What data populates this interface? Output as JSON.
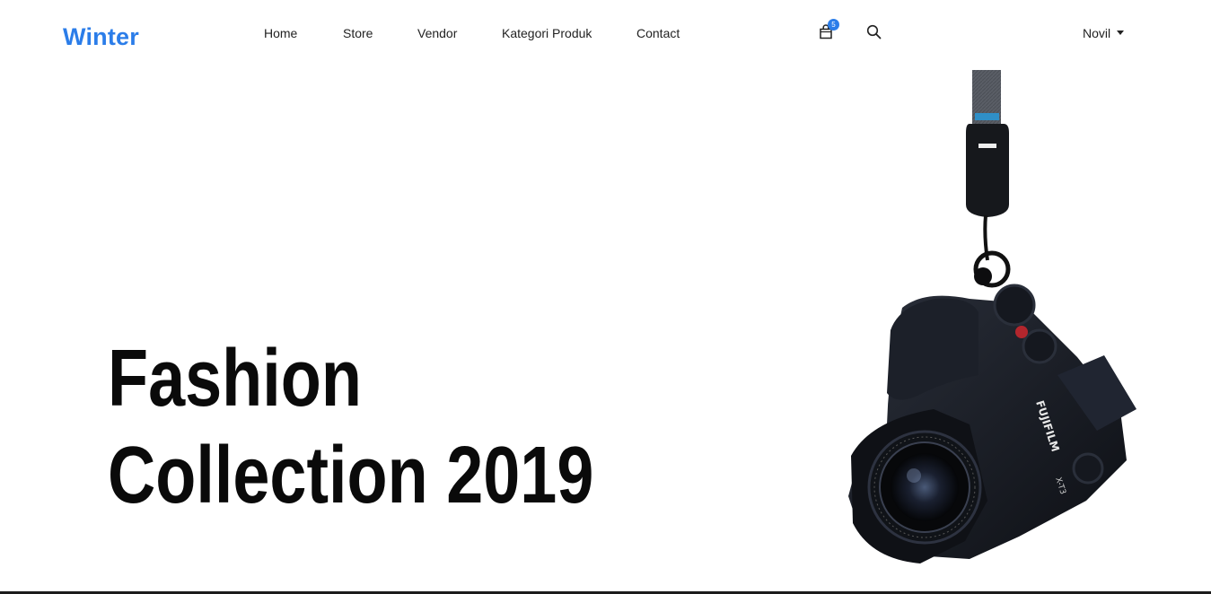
{
  "brand": {
    "name": "Winter",
    "color": "#2b7de9"
  },
  "nav": {
    "items": [
      {
        "label": "Home"
      },
      {
        "label": "Store"
      },
      {
        "label": "Vendor"
      },
      {
        "label": "Kategori Produk"
      },
      {
        "label": "Contact"
      }
    ]
  },
  "cart": {
    "icon": "shopping-bag-icon",
    "count": "5"
  },
  "search": {
    "icon": "search-icon"
  },
  "user": {
    "name": "Novil",
    "icon": "caret-down-icon"
  },
  "hero": {
    "title_line1": "Fashion",
    "title_line2": "Collection 2019",
    "image": {
      "subject": "camera-image",
      "brand_text": "FUJIFILM",
      "model_text": "X-T3"
    }
  }
}
